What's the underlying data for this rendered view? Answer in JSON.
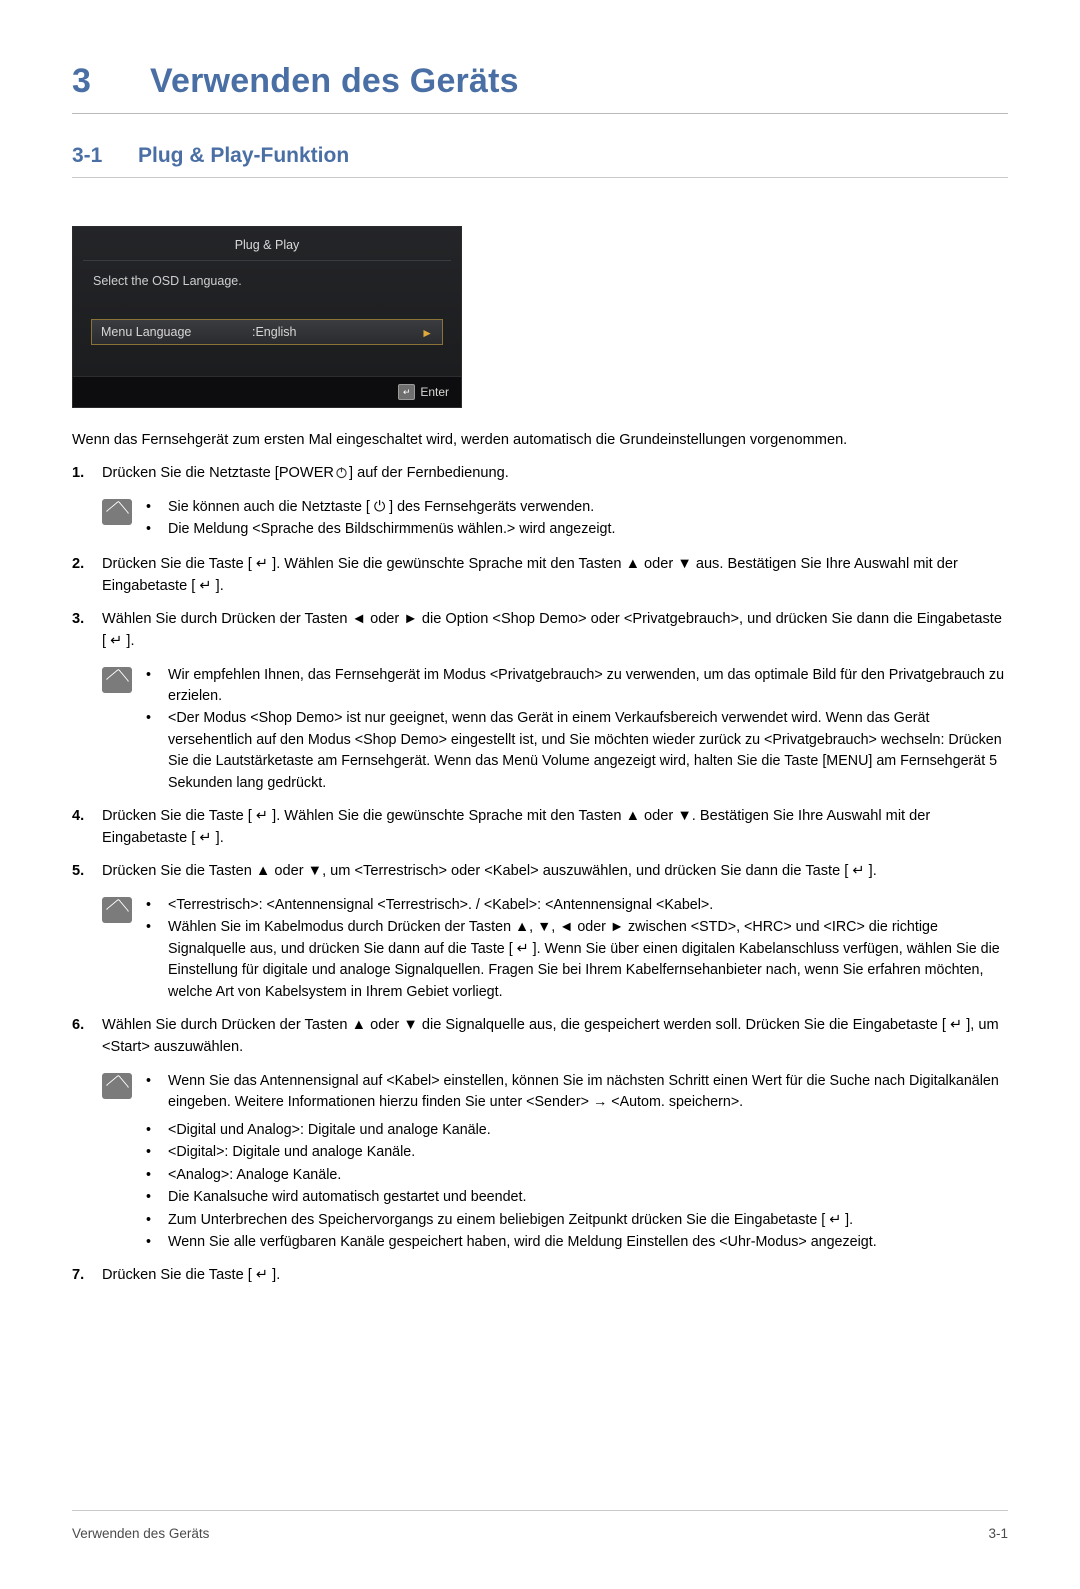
{
  "chapter": {
    "number": "3",
    "title": "Verwenden des Geräts"
  },
  "section": {
    "number": "3-1",
    "title": "Plug & Play-Funktion"
  },
  "osd": {
    "title": "Plug & Play",
    "subtitle": "Select the OSD Language.",
    "row_label": "Menu Language",
    "row_value": ":English",
    "row_arrow": "►",
    "enter_key": "↵",
    "enter_label": "Enter"
  },
  "intro": "Wenn das Fernsehgerät zum ersten Mal eingeschaltet wird, werden automatisch die Grundeinstellungen vorgenommen.",
  "steps": [
    {
      "number": "1.",
      "text_before": "Drücken Sie die Netztaste [POWER",
      "text_after": "] auf der Fernbedienung."
    }
  ],
  "note1": {
    "bullets": [
      "Sie können auch die Netztaste [ ⏻ ] des Fernsehgeräts verwenden.",
      "Die Meldung <Sprache des Bildschirmmenüs wählen.> wird angezeigt."
    ]
  },
  "step2": {
    "number": "2.",
    "text": "Drücken Sie die Taste [ ↵ ]. Wählen Sie die gewünschte Sprache mit den Tasten ▲ oder ▼ aus. Bestätigen Sie Ihre Auswahl mit der Eingabetaste [ ↵ ]."
  },
  "step3": {
    "number": "3.",
    "text": "Wählen Sie durch Drücken der Tasten ◄ oder ► die Option <Shop Demo> oder <Privatgebrauch>, und drücken Sie dann die Eingabetaste [ ↵ ]."
  },
  "note2": {
    "bullets": [
      "Wir empfehlen Ihnen, das Fernsehgerät im Modus <Privatgebrauch> zu verwenden, um das optimale Bild für den Privatgebrauch zu erzielen.",
      "<Der Modus <Shop Demo> ist nur geeignet, wenn das Gerät in einem Verkaufsbereich verwendet wird. Wenn das Gerät versehentlich auf den Modus <Shop Demo> eingestellt ist, und Sie möchten wieder zurück zu <Privatgebrauch> wechseln: Drücken Sie die Lautstärketaste am Fernsehgerät. Wenn das Menü Volume angezeigt wird, halten Sie die Taste [MENU] am Fernsehgerät 5 Sekunden lang gedrückt."
    ]
  },
  "step4": {
    "number": "4.",
    "text": "Drücken Sie die Taste [ ↵ ]. Wählen Sie die gewünschte Sprache mit den Tasten ▲ oder ▼. Bestätigen Sie Ihre Auswahl mit der Eingabetaste [ ↵ ]."
  },
  "step5": {
    "number": "5.",
    "text": "Drücken Sie die Tasten ▲ oder ▼, um <Terrestrisch> oder <Kabel> auszuwählen, und drücken Sie dann die Taste [ ↵ ]."
  },
  "note3": {
    "bullets": [
      "<Terrestrisch>: <Antennensignal <Terrestrisch>. / <Kabel>: <Antennensignal <Kabel>.",
      "Wählen Sie im Kabelmodus durch Drücken der Tasten ▲, ▼, ◄ oder ► zwischen <STD>, <HRC> und <IRC> die richtige Signalquelle aus, und drücken Sie dann auf die Taste [ ↵ ]. Wenn Sie über einen digitalen Kabelanschluss verfügen, wählen Sie die Einstellung für digitale und analoge Signalquellen. Fragen Sie bei Ihrem Kabelfernsehanbieter nach, wenn Sie erfahren möchten, welche Art von Kabelsystem in Ihrem Gebiet vorliegt."
    ]
  },
  "step6": {
    "number": "6.",
    "text": "Wählen Sie durch Drücken der Tasten ▲ oder ▼ die Signalquelle aus, die gespeichert werden soll. Drücken Sie die Eingabetaste [ ↵ ], um <Start> auszuwählen."
  },
  "note4": {
    "bullets": [
      "Wenn Sie das Antennensignal auf <Kabel> einstellen, können Sie im nächsten Schritt einen Wert für die Suche nach Digitalkanälen eingeben. Weitere Informationen hierzu finden Sie unter <Sender> → <Autom. speichern>."
    ]
  },
  "plain_bullets": [
    "<Digital und Analog>: Digitale und analoge Kanäle.",
    "<Digital>: Digitale und analoge Kanäle.",
    "<Analog>: Analoge Kanäle.",
    "Die Kanalsuche wird automatisch gestartet und beendet.",
    "Zum Unterbrechen des Speichervorgangs zu einem beliebigen Zeitpunkt drücken Sie die Eingabetaste [ ↵ ].",
    "Wenn Sie alle verfügbaren Kanäle gespeichert haben, wird die Meldung Einstellen des <Uhr-Modus> angezeigt."
  ],
  "step7": {
    "number": "7.",
    "text": "Drücken Sie die Taste [ ↵ ]."
  },
  "footer": {
    "left": "Verwenden des Geräts",
    "right": "3-1"
  },
  "colors": {
    "heading": "#4a6fa5",
    "rule": "#c8c8c8",
    "osd_highlight": "#8a7336"
  }
}
